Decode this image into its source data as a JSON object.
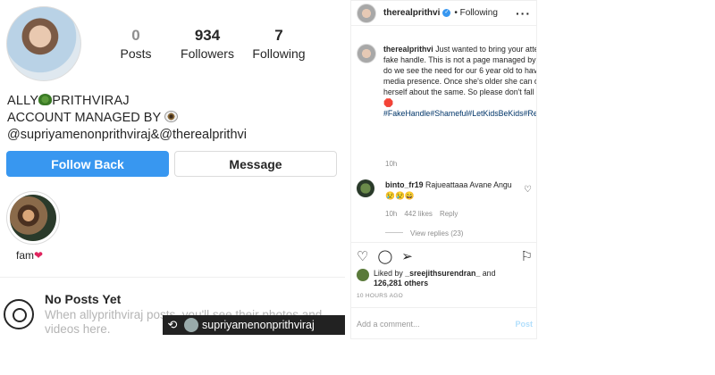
{
  "profile": {
    "stats": [
      {
        "num": "0",
        "label": "Posts"
      },
      {
        "num": "934",
        "label": "Followers"
      },
      {
        "num": "7",
        "label": "Following"
      }
    ],
    "name_part1": "ALLY",
    "name_part2": "PRITHVIRAJ",
    "bio_line2": "ACCOUNT MANAGED BY",
    "bio_line3": "@supriyamenonprithviraj&@therealprithvi",
    "follow_back": "Follow Back",
    "message": "Message",
    "highlight_label": "fam",
    "no_posts_title": "No Posts Yet",
    "no_posts_desc": "When allyprithviraj posts, you'll see their photos and videos here.",
    "repost_handle": "supriyamenonprithviraj"
  },
  "post": {
    "username": "therealprithvi",
    "following": "• Following",
    "caption_user": "therealprithvi",
    "caption": "Just wanted to bring your attention to this fake handle. This is not a page managed by us and neither do we see the need for our 6 year old to have a social media presence. Once she's older she can decide for herself about the same. So please don't fall prey to this!",
    "hashtags": "#FakeHandle#Shameful#LetKidsBeKids#ReportThisHandle",
    "time": "10h",
    "comment_user": "binto_fr19",
    "comment_text": "Rajueattaaa Avane Angu",
    "comment_time": "10h",
    "comment_likes": "442 likes",
    "reply": "Reply",
    "view_replies": "View replies (23)",
    "liked_by_prefix": "Liked by",
    "liked_by_user": "_sreejithsurendran_",
    "liked_by_and": "and",
    "liked_by_count": "126,281 others",
    "ago": "10 HOURS AGO",
    "comment_placeholder": "Add a comment...",
    "post_label": "Post"
  },
  "colors": {
    "accent": "#3897f0",
    "text": "#262626",
    "muted": "#8e8e8e",
    "hashtag": "#003569"
  }
}
